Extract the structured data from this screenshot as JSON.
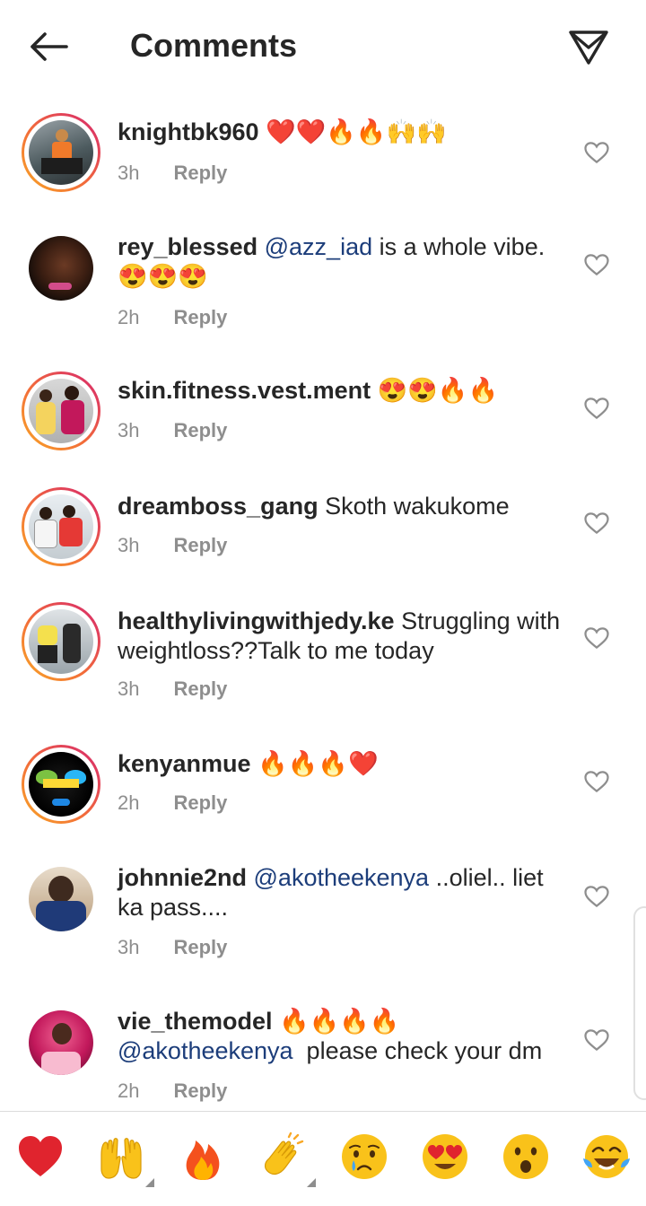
{
  "header": {
    "title": "Comments"
  },
  "comments": [
    {
      "user": "knightbk960",
      "mention": "",
      "text": "",
      "emoji": "❤️❤️🔥🔥🙌🙌",
      "time": "3h",
      "reply": "Reply"
    },
    {
      "user": "rey_blessed",
      "mention": "@azz_iad",
      "text": " is a whole vibe.",
      "emoji": "😍😍😍",
      "time": "2h",
      "reply": "Reply"
    },
    {
      "user": "skin.fitness.vest.ment",
      "mention": "",
      "text": "",
      "emoji": "😍😍🔥🔥",
      "time": "3h",
      "reply": "Reply"
    },
    {
      "user": "dreamboss_gang",
      "mention": "",
      "text": " Skoth wakukome",
      "emoji": "",
      "time": "3h",
      "reply": "Reply"
    },
    {
      "user": "healthylivingwithjedy.ke",
      "mention": "",
      "text": " Struggling with weightloss??Talk to me today",
      "emoji": "",
      "time": "3h",
      "reply": "Reply"
    },
    {
      "user": "kenyanmue",
      "mention": "",
      "text": "",
      "emoji": "🔥🔥🔥❤️",
      "time": "2h",
      "reply": "Reply"
    },
    {
      "user": "johnnie2nd",
      "mention": "@akotheekenya",
      "text": " ..oliel.. liet ka pass....",
      "emoji": "",
      "time": "3h",
      "reply": "Reply"
    },
    {
      "user": "vie_themodel",
      "mention": "@akotheekenya",
      "text": "  please check your dm",
      "emoji": "🔥🔥🔥🔥",
      "time": "2h",
      "reply": "Reply"
    }
  ],
  "reactions": [
    "❤️",
    "🙌",
    "🔥",
    "👏",
    "😢",
    "😍",
    "😮",
    "😂"
  ],
  "colors": {
    "accent_mention": "#1c3d7a",
    "meta_gray": "#8e8e8e",
    "text": "#262626"
  }
}
